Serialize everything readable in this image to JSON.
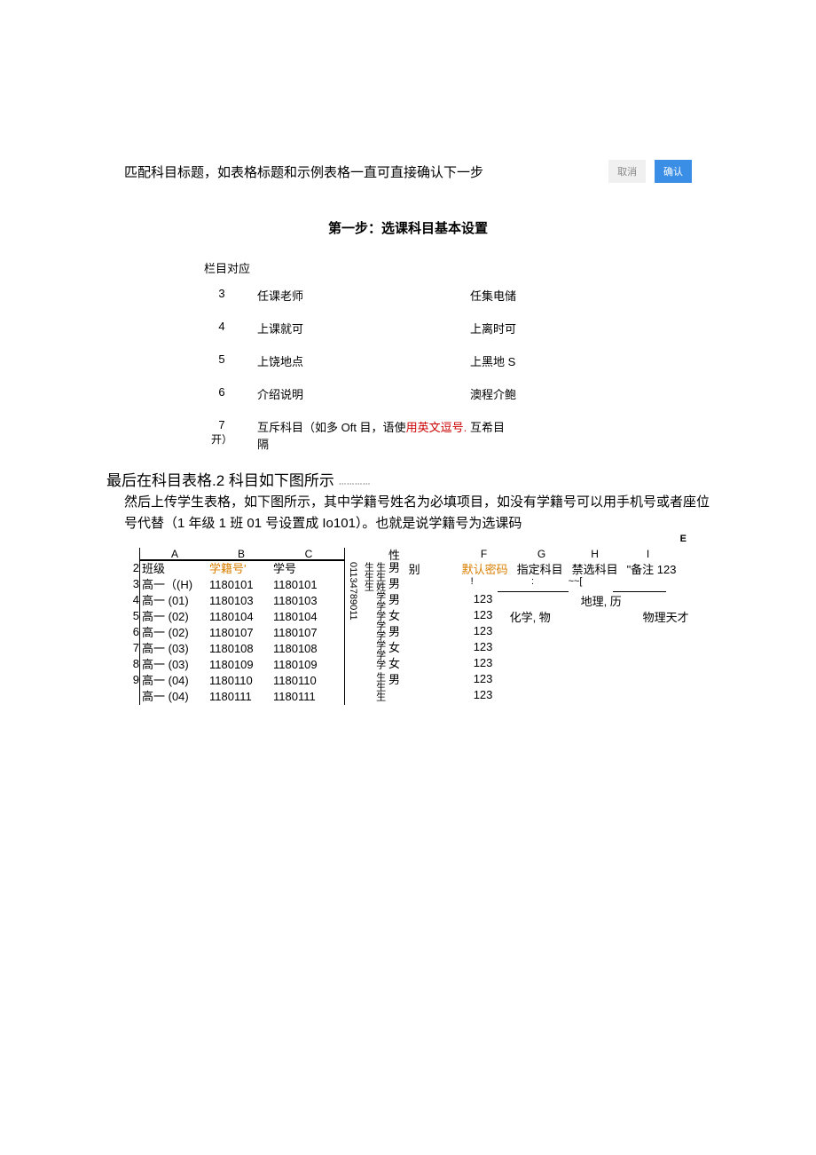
{
  "intro": "匹配科目标题，如表格标题和示例表格一直可直接确认下一步",
  "buttons": {
    "cancel": "取消",
    "confirm": "确认"
  },
  "step_title": "第一步：选课科目基本设置",
  "mapping": {
    "header": "栏目对应",
    "rows": [
      {
        "num": "3",
        "left": "任课老师",
        "right": "任集电储"
      },
      {
        "num": "4",
        "left": "上课就可",
        "right": "上离时可"
      },
      {
        "num": "5",
        "left": "上饶地点",
        "right": "上黑地 S"
      },
      {
        "num": "6",
        "left": "介绍说明",
        "right": "澳程介鲍"
      },
      {
        "num": "7",
        "num_suffix": "开）",
        "left_pre": "互斥科目（如多 Oft 目，语使",
        "left_red": "用英文逗号.",
        "left_post": "隔",
        "right": "互希目"
      }
    ]
  },
  "bold_line": "最后在科目表格.2 科目如下图所示",
  "bold_sub": "…………",
  "para": "然后上传学生表格，如下图所示，其中学籍号姓名为必填项目，如没有学籍号可以用手机号或者座位号代替（1 年级 1 班 01 号设置成 Io101）。也就是说学籍号为选课码",
  "table": {
    "col_letters": {
      "a": "A",
      "b": "B",
      "c": "C"
    },
    "header": {
      "a": "班级",
      "b": "学籍号'",
      "c": "学号"
    },
    "row_nums": [
      "2",
      "3",
      "4",
      "5",
      "6",
      "7",
      "8",
      "9"
    ],
    "rows": [
      {
        "a": "高一（(H)",
        "b": "1180101",
        "c": "1180101"
      },
      {
        "a": "高一 (01)",
        "b": "1180103",
        "c": "1180103"
      },
      {
        "a": "高一 (02)",
        "b": "1180104",
        "c": "1180104"
      },
      {
        "a": "高一 (02)",
        "b": "1180107",
        "c": "1180107"
      },
      {
        "a": "高一 (03)",
        "b": "1180108",
        "c": "1180108"
      },
      {
        "a": "高一 (03)",
        "b": "1180109",
        "c": "1180109"
      },
      {
        "a": "高一  (04)",
        "b": "1180110",
        "c": "1180110"
      },
      {
        "a": "高一 (04)",
        "b": "1180111",
        "c": "1180111"
      }
    ],
    "vertical_d": "01134789011",
    "name_col_header": "生生姓学学学学学学学学",
    "name_col_sub": "生生生生生生",
    "gender_header": "性别",
    "genders": [
      "男",
      "男",
      "男",
      "女",
      "男",
      "女",
      "女",
      "男",
      ""
    ],
    "right_letters": {
      "e": "E",
      "f": "F",
      "g": "G",
      "h": "H",
      "i": "I"
    },
    "right_header": {
      "bie": "别",
      "pwd": "默认密码",
      "sub": "指定科目",
      "ban": "禁选科目",
      "note": "\"备注 123"
    },
    "scribble": {
      "a": "!",
      "b": ":",
      "c": "~~["
    },
    "right_rows": [
      {
        "pwd": "",
        "sub": "",
        "ban": "",
        "note": ""
      },
      {
        "pwd": "123",
        "sub": "",
        "ban": "地理, 历",
        "note": ""
      },
      {
        "pwd": "123",
        "sub": "化学, 物",
        "ban": "",
        "note": "物理天才"
      },
      {
        "pwd": "123",
        "sub": "",
        "ban": "",
        "note": ""
      },
      {
        "pwd": "123",
        "sub": "",
        "ban": "",
        "note": ""
      },
      {
        "pwd": "123",
        "sub": "",
        "ban": "",
        "note": ""
      },
      {
        "pwd": "123",
        "sub": "",
        "ban": "",
        "note": ""
      },
      {
        "pwd": "123",
        "sub": "",
        "ban": "",
        "note": ""
      }
    ]
  }
}
